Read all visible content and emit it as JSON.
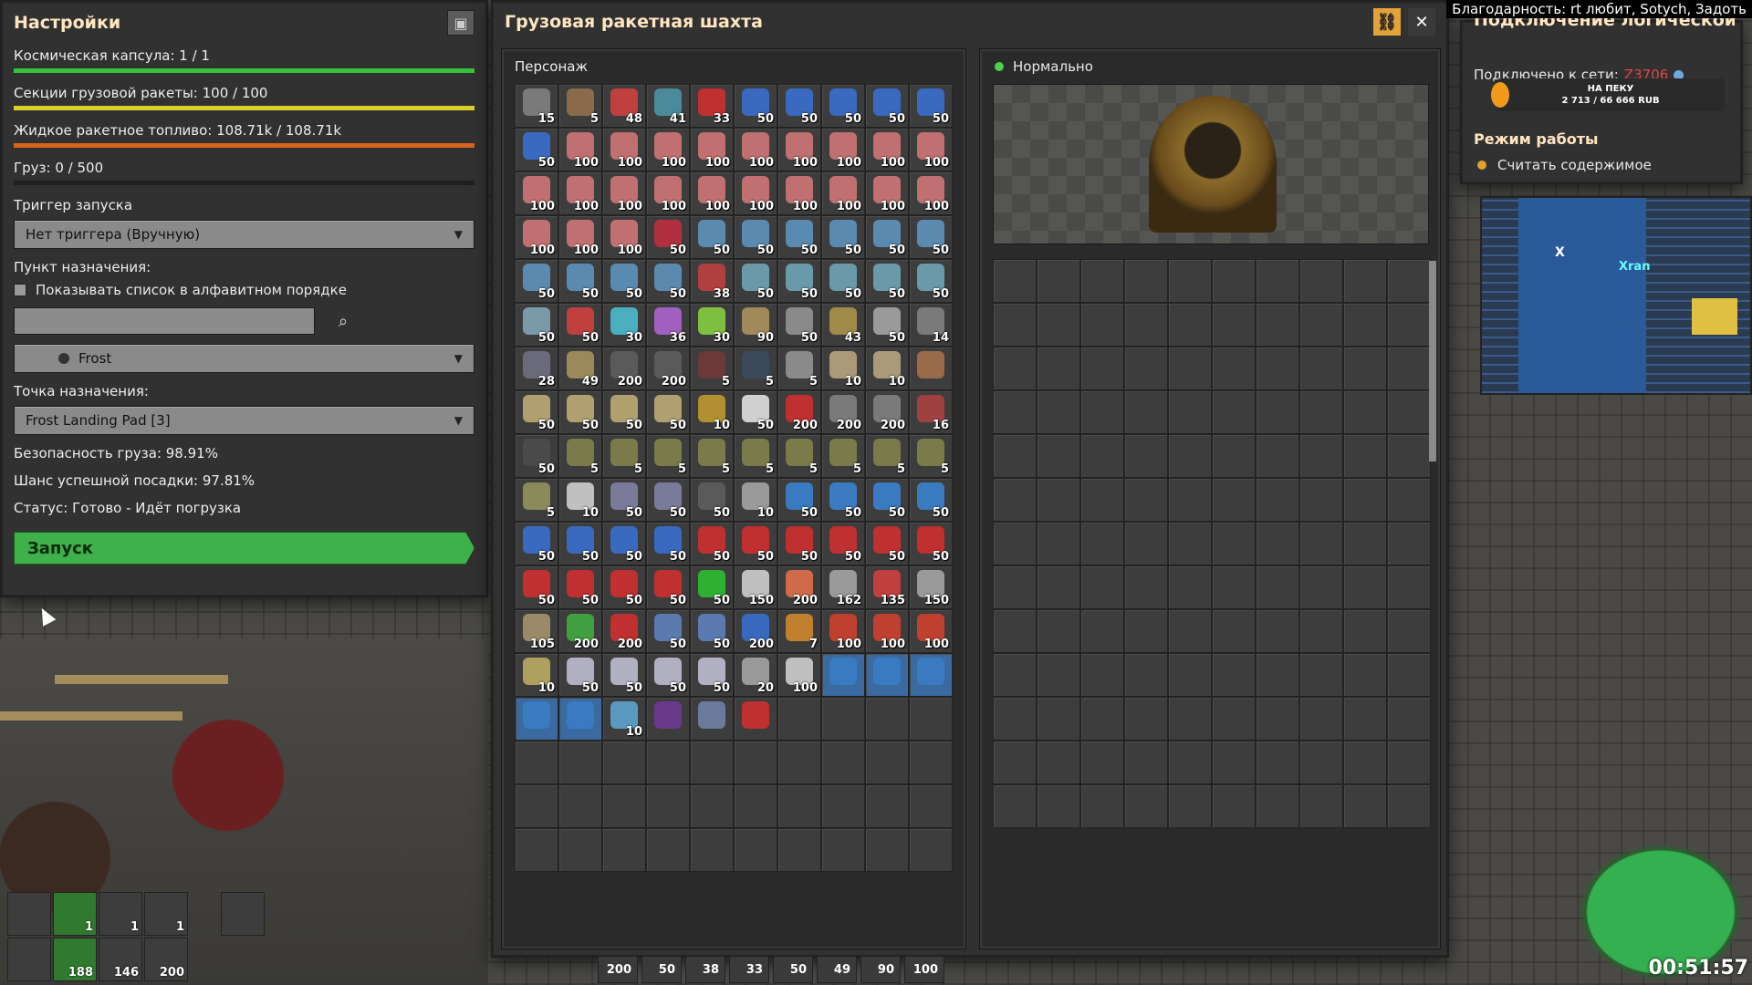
{
  "settings": {
    "title": "Настройки",
    "capsule": "Космическая капсула: 1 / 1",
    "sections": "Секции грузовой ракеты: 100 / 100",
    "fuel": "Жидкое ракетное топливо: 108.71k / 108.71k",
    "cargo": "Груз: 0 / 500",
    "bars": {
      "capsule": {
        "fraction": 1.0,
        "color": "#36c33a"
      },
      "sections": {
        "fraction": 1.0,
        "color": "#d8d02a"
      },
      "fuel": {
        "fraction": 1.0,
        "color": "#d8641e"
      },
      "cargo": {
        "fraction": 0.0,
        "color": "#888888"
      }
    },
    "trigger_label": "Триггер запуска",
    "trigger_value": "Нет триггера (Вручную)",
    "destination_label": "Пункт назначения:",
    "alpha_sort_label": "Показывать список в алфавитном порядке",
    "planet_value": "Frost",
    "dest_point_label": "Точка назначения:",
    "dest_point_value": "Frost Landing Pad [3]",
    "safety": "Безопасность груза: 98.91%",
    "landing_chance": "Шанс успешной посадки: 97.81%",
    "status": "Статус: Готово - Идёт погрузка",
    "launch_label": "Запуск"
  },
  "silo": {
    "title": "Грузовая ракетная шахта",
    "character_label": "Персонаж",
    "status_label": "Нормально",
    "inventory": [
      {
        "c": "15",
        "col": "#7a7a7a"
      },
      {
        "c": "5",
        "col": "#8a6a4a"
      },
      {
        "c": "48",
        "col": "#c04040"
      },
      {
        "c": "41",
        "col": "#4a8a9a"
      },
      {
        "c": "33",
        "col": "#c03030"
      },
      {
        "c": "50",
        "col": "#3a6ac0"
      },
      {
        "c": "50",
        "col": "#3a6ac0"
      },
      {
        "c": "50",
        "col": "#3a6ac0"
      },
      {
        "c": "50",
        "col": "#3a6ac0"
      },
      {
        "c": "50",
        "col": "#3a6ac0"
      },
      {
        "c": "50",
        "col": "#3a6ac0"
      },
      {
        "c": "100",
        "col": "#c07070"
      },
      {
        "c": "100",
        "col": "#c07070"
      },
      {
        "c": "100",
        "col": "#c07070"
      },
      {
        "c": "100",
        "col": "#c07070"
      },
      {
        "c": "100",
        "col": "#c07070"
      },
      {
        "c": "100",
        "col": "#c07070"
      },
      {
        "c": "100",
        "col": "#c07070"
      },
      {
        "c": "100",
        "col": "#c07070"
      },
      {
        "c": "100",
        "col": "#c07070"
      },
      {
        "c": "100",
        "col": "#c07070"
      },
      {
        "c": "100",
        "col": "#c07070"
      },
      {
        "c": "100",
        "col": "#c07070"
      },
      {
        "c": "100",
        "col": "#c07070"
      },
      {
        "c": "100",
        "col": "#c07070"
      },
      {
        "c": "100",
        "col": "#c07070"
      },
      {
        "c": "100",
        "col": "#c07070"
      },
      {
        "c": "100",
        "col": "#c07070"
      },
      {
        "c": "100",
        "col": "#c07070"
      },
      {
        "c": "100",
        "col": "#c07070"
      },
      {
        "c": "100",
        "col": "#c07070"
      },
      {
        "c": "100",
        "col": "#c07070"
      },
      {
        "c": "100",
        "col": "#c07070"
      },
      {
        "c": "50",
        "col": "#b03040"
      },
      {
        "c": "50",
        "col": "#5a8ab0"
      },
      {
        "c": "50",
        "col": "#5a8ab0"
      },
      {
        "c": "50",
        "col": "#5a8ab0"
      },
      {
        "c": "50",
        "col": "#5a8ab0"
      },
      {
        "c": "50",
        "col": "#5a8ab0"
      },
      {
        "c": "50",
        "col": "#5a8ab0"
      },
      {
        "c": "50",
        "col": "#5a8ab0"
      },
      {
        "c": "50",
        "col": "#5a8ab0"
      },
      {
        "c": "50",
        "col": "#5a8ab0"
      },
      {
        "c": "50",
        "col": "#5a8ab0"
      },
      {
        "c": "38",
        "col": "#b04040"
      },
      {
        "c": "50",
        "col": "#6a9aaa"
      },
      {
        "c": "50",
        "col": "#6a9aaa"
      },
      {
        "c": "50",
        "col": "#6a9aaa"
      },
      {
        "c": "50",
        "col": "#6a9aaa"
      },
      {
        "c": "50",
        "col": "#6a9aaa"
      },
      {
        "c": "50",
        "col": "#7a9aaa"
      },
      {
        "c": "50",
        "col": "#c04040"
      },
      {
        "c": "30",
        "col": "#4ab0c0"
      },
      {
        "c": "36",
        "col": "#a060c0"
      },
      {
        "c": "30",
        "col": "#80c040"
      },
      {
        "c": "90",
        "col": "#a08a5a"
      },
      {
        "c": "50",
        "col": "#8a8a8a"
      },
      {
        "c": "43",
        "col": "#a08a4a"
      },
      {
        "c": "50",
        "col": "#9a9a9a"
      },
      {
        "c": "14",
        "col": "#7a7a7a"
      },
      {
        "c": "28",
        "col": "#6a6a7a"
      },
      {
        "c": "49",
        "col": "#9a8a5a"
      },
      {
        "c": "200",
        "col": "#5a5a5a"
      },
      {
        "c": "200",
        "col": "#5a5a5a"
      },
      {
        "c": "5",
        "col": "#6a3a3a"
      },
      {
        "c": "5",
        "col": "#3a4a5a"
      },
      {
        "c": "5",
        "col": "#8a8a8a"
      },
      {
        "c": "10",
        "col": "#aa9a7a"
      },
      {
        "c": "10",
        "col": "#aa9a7a"
      },
      {
        "c": "",
        "col": "#9a6a4a"
      },
      {
        "c": "50",
        "col": "#b0a070"
      },
      {
        "c": "50",
        "col": "#b0a070"
      },
      {
        "c": "50",
        "col": "#b0a070"
      },
      {
        "c": "50",
        "col": "#b0a070"
      },
      {
        "c": "10",
        "col": "#b09030"
      },
      {
        "c": "50",
        "col": "#d0d0d0"
      },
      {
        "c": "200",
        "col": "#c03030"
      },
      {
        "c": "200",
        "col": "#7a7a7a"
      },
      {
        "c": "200",
        "col": "#7a7a7a"
      },
      {
        "c": "16",
        "col": "#a04040"
      },
      {
        "c": "50",
        "col": "#4a4a4a"
      },
      {
        "c": "5",
        "col": "#7a7a4a"
      },
      {
        "c": "5",
        "col": "#7a7a4a"
      },
      {
        "c": "5",
        "col": "#7a7a4a"
      },
      {
        "c": "5",
        "col": "#7a7a4a"
      },
      {
        "c": "5",
        "col": "#7a7a4a"
      },
      {
        "c": "5",
        "col": "#7a7a4a"
      },
      {
        "c": "5",
        "col": "#7a7a4a"
      },
      {
        "c": "5",
        "col": "#7a7a4a"
      },
      {
        "c": "5",
        "col": "#7a7a4a"
      },
      {
        "c": "5",
        "col": "#8a8a5a"
      },
      {
        "c": "10",
        "col": "#c0c0c0"
      },
      {
        "c": "50",
        "col": "#7a7a9a"
      },
      {
        "c": "50",
        "col": "#7a7a9a"
      },
      {
        "c": "50",
        "col": "#5a5a5a"
      },
      {
        "c": "10",
        "col": "#9a9a9a"
      },
      {
        "c": "50",
        "col": "#3a7ac0"
      },
      {
        "c": "50",
        "col": "#3a7ac0"
      },
      {
        "c": "50",
        "col": "#3a7ac0"
      },
      {
        "c": "50",
        "col": "#3a7ac0"
      },
      {
        "c": "50",
        "col": "#3a6ac0"
      },
      {
        "c": "50",
        "col": "#3a6ac0"
      },
      {
        "c": "50",
        "col": "#3a6ac0"
      },
      {
        "c": "50",
        "col": "#3a6ac0"
      },
      {
        "c": "50",
        "col": "#c03030"
      },
      {
        "c": "50",
        "col": "#c03030"
      },
      {
        "c": "50",
        "col": "#c03030"
      },
      {
        "c": "50",
        "col": "#c03030"
      },
      {
        "c": "50",
        "col": "#c03030"
      },
      {
        "c": "50",
        "col": "#c03030"
      },
      {
        "c": "50",
        "col": "#c03030"
      },
      {
        "c": "50",
        "col": "#c03030"
      },
      {
        "c": "50",
        "col": "#c03030"
      },
      {
        "c": "50",
        "col": "#c03030"
      },
      {
        "c": "50",
        "col": "#30b030"
      },
      {
        "c": "150",
        "col": "#c0c0c0"
      },
      {
        "c": "200",
        "col": "#d06a4a"
      },
      {
        "c": "162",
        "col": "#9a9a9a"
      },
      {
        "c": "135",
        "col": "#c04040"
      },
      {
        "c": "150",
        "col": "#9a9a9a"
      },
      {
        "c": "105",
        "col": "#9a8a6a"
      },
      {
        "c": "200",
        "col": "#40a040"
      },
      {
        "c": "200",
        "col": "#c03030"
      },
      {
        "c": "50",
        "col": "#5a7ab0"
      },
      {
        "c": "50",
        "col": "#5a7ab0"
      },
      {
        "c": "200",
        "col": "#3a6ac0"
      },
      {
        "c": "7",
        "col": "#c08030"
      },
      {
        "c": "100",
        "col": "#c04030"
      },
      {
        "c": "100",
        "col": "#c04030"
      },
      {
        "c": "100",
        "col": "#c04030"
      },
      {
        "c": "10",
        "col": "#b0a060"
      },
      {
        "c": "50",
        "col": "#b0b0c0"
      },
      {
        "c": "50",
        "col": "#b0b0c0"
      },
      {
        "c": "50",
        "col": "#b0b0c0"
      },
      {
        "c": "50",
        "col": "#b0b0c0"
      },
      {
        "c": "20",
        "col": "#9a9a9a"
      },
      {
        "c": "100",
        "col": "#c0c0c0"
      },
      {
        "c": "",
        "col": "#3a7ac0",
        "blue": true
      },
      {
        "c": "",
        "col": "#3a7ac0",
        "blue": true
      },
      {
        "c": "",
        "col": "#3a7ac0",
        "blue": true
      },
      {
        "c": "",
        "col": "#3a7ac0",
        "blue": true
      },
      {
        "c": "",
        "col": "#3a7ac0",
        "blue": true
      },
      {
        "c": "10",
        "col": "#5a9ac0"
      },
      {
        "c": "",
        "col": "#6a3a8a"
      },
      {
        "c": "",
        "col": "#6a7a9a"
      },
      {
        "c": "",
        "col": "#c03030"
      },
      {
        "c": "",
        "col": ""
      },
      {
        "c": "",
        "col": ""
      },
      {
        "c": "",
        "col": ""
      },
      {
        "c": "",
        "col": ""
      }
    ]
  },
  "logic": {
    "title": "Подключение логической ...",
    "connected_label": "Подключено к сети:",
    "connected_value": "Z3706",
    "donation_line1": "НА ПЕКУ",
    "donation_line2": "2 713 / 66 666 RUB",
    "mode_heading": "Режим работы",
    "mode_option": "Считать содержимое"
  },
  "minimap": {
    "label": "Xran",
    "marker": "X"
  },
  "stream": {
    "thanks": "Благодарность: rt любит, Sotych, Задоть",
    "clock": "00:51:57"
  },
  "quickbar": [
    {
      "c": "",
      "col": "#9a7a5a"
    },
    {
      "c": "1",
      "col": "#40a040",
      "green": true
    },
    {
      "c": "1",
      "col": "#9a9a9a"
    },
    {
      "c": "1",
      "col": "#9a9a9a"
    },
    {
      "c": "",
      "col": "#6a3a8a"
    },
    {
      "c": "188",
      "col": "#c03030",
      "green": true
    },
    {
      "c": "146",
      "col": "#9a9a9a"
    },
    {
      "c": "200",
      "col": "#b0a060"
    }
  ],
  "bottombar": [
    "200",
    "50",
    "38",
    "33",
    "50",
    "49",
    "90",
    "100"
  ]
}
